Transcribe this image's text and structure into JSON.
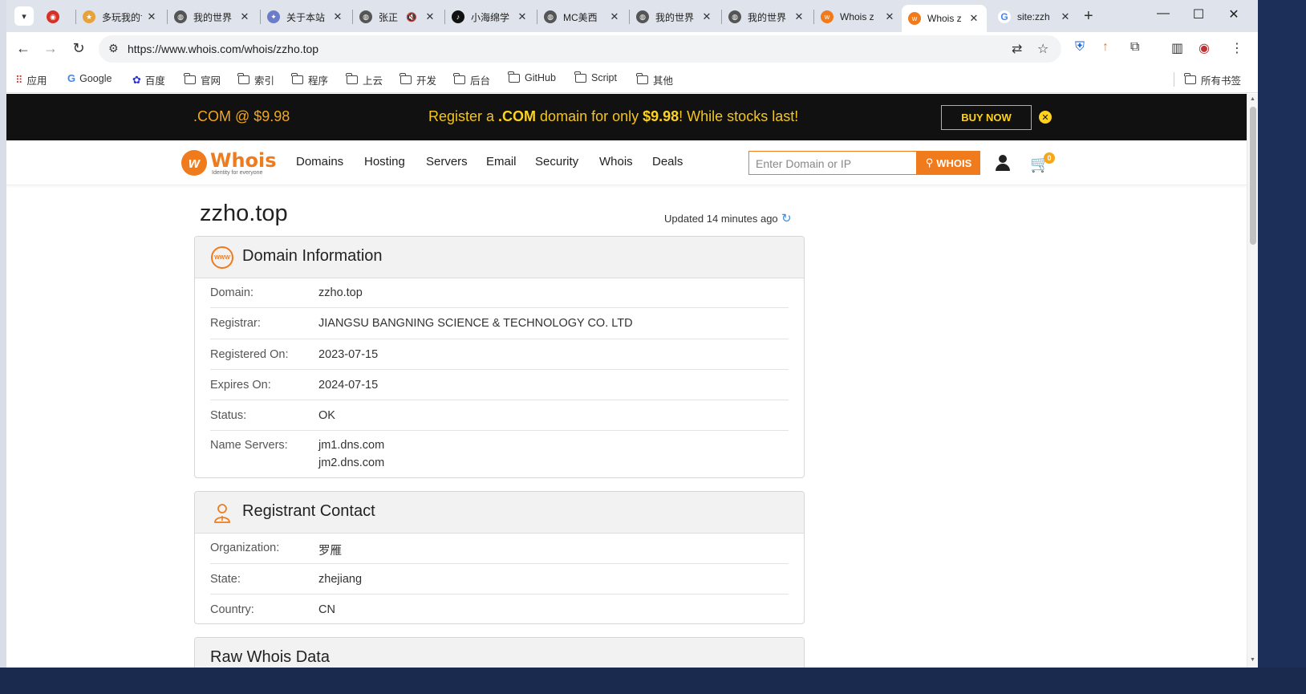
{
  "browser": {
    "tabs": [
      {
        "title": "",
        "icon": "media-icon",
        "color": "#d93025"
      },
      {
        "title": "多玩我的世界",
        "icon": "game-icon",
        "color": "#e8a23a"
      },
      {
        "title": "我的世界",
        "icon": "globe-icon",
        "color": "#555555"
      },
      {
        "title": "关于本站",
        "icon": "site-icon",
        "color": "#6b7cc9"
      },
      {
        "title": "张正",
        "icon": "globe-icon",
        "color": "#555555"
      },
      {
        "title": "小海绵学",
        "icon": "tiktok-icon",
        "color": "#111111"
      },
      {
        "title": "MC美西",
        "icon": "globe-icon",
        "color": "#555555"
      },
      {
        "title": "我的世界",
        "icon": "globe-icon",
        "color": "#555555"
      },
      {
        "title": "我的世界",
        "icon": "globe-icon",
        "color": "#555555"
      },
      {
        "title": "Whois z",
        "icon": "whois-icon",
        "color": "#f07b1d"
      },
      {
        "title": "Whois z",
        "icon": "whois-icon",
        "color": "#f07b1d"
      },
      {
        "title": "site:zzh",
        "icon": "google-icon",
        "color": "#4285f4"
      }
    ],
    "url": "https://www.whois.com/whois/zzho.top",
    "bookmarks": [
      {
        "label": "应用",
        "icon": "apps-icon"
      },
      {
        "label": "Google",
        "icon": "google-icon"
      },
      {
        "label": "百度",
        "icon": "baidu-icon"
      },
      {
        "label": "官网",
        "icon": "folder-icon"
      },
      {
        "label": "索引",
        "icon": "folder-icon"
      },
      {
        "label": "程序",
        "icon": "folder-icon"
      },
      {
        "label": "上云",
        "icon": "folder-icon"
      },
      {
        "label": "开发",
        "icon": "folder-icon"
      },
      {
        "label": "后台",
        "icon": "folder-icon"
      },
      {
        "label": "GitHub",
        "icon": "folder-icon"
      },
      {
        "label": "Script",
        "icon": "folder-icon"
      },
      {
        "label": "其他",
        "icon": "folder-icon"
      }
    ],
    "all_bookmarks": "所有书签"
  },
  "promo": {
    "left": ".COM @ $9.98",
    "msg_pre": "Register a ",
    "msg_com": ".COM",
    "msg_mid": " domain for only ",
    "msg_price": "$9.98",
    "msg_post": "! While stocks last!",
    "buy": "BUY NOW"
  },
  "site": {
    "logo": "Whois",
    "tagline": "Identity for everyone",
    "menu": [
      "Domains",
      "Hosting",
      "Servers",
      "Email",
      "Security",
      "Whois",
      "Deals"
    ],
    "search_placeholder": "Enter Domain or IP",
    "search_button": "WHOIS",
    "cart_count": "0"
  },
  "page": {
    "domain": "zzho.top",
    "updated": "Updated 14 minutes ago"
  },
  "domain_info": {
    "title": "Domain Information",
    "rows": [
      {
        "key": "Domain:",
        "value": "zzho.top"
      },
      {
        "key": "Registrar:",
        "value": "JIANGSU BANGNING SCIENCE & TECHNOLOGY CO. LTD"
      },
      {
        "key": "Registered On:",
        "value": "2023-07-15"
      },
      {
        "key": "Expires On:",
        "value": "2024-07-15"
      },
      {
        "key": "Status:",
        "value": "OK"
      },
      {
        "key": "Name Servers:",
        "value": "jm1.dns.com",
        "value2": "jm2.dns.com"
      }
    ]
  },
  "registrant": {
    "title": "Registrant Contact",
    "rows": [
      {
        "key": "Organization:",
        "value": "罗雁"
      },
      {
        "key": "State:",
        "value": "zhejiang"
      },
      {
        "key": "Country:",
        "value": "CN"
      }
    ]
  },
  "raw": {
    "title": "Raw Whois Data"
  }
}
